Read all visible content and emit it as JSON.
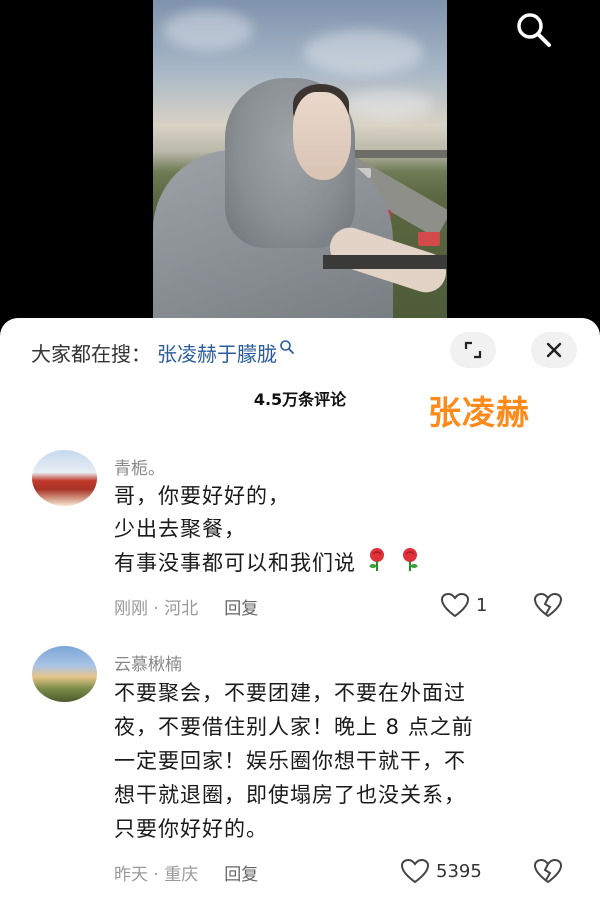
{
  "search_bar": {
    "label": "大家都在搜：",
    "term": "张凌赫于朦胧"
  },
  "comment_count": "4.5万条评论",
  "watermark": "张凌赫",
  "comments": [
    {
      "user": "青栀。",
      "lines": [
        "哥，你要好好的，",
        "少出去聚餐，",
        "有事没事都可以和我们说"
      ],
      "emoji": "rose",
      "time_location": "刚刚 · 河北",
      "reply": "回复",
      "likes": "1"
    },
    {
      "user": "云慕楸楠",
      "lines": [
        "不要聚会，不要团建，不要在外面过",
        "夜，不要借住别人家！晚上 8 点之前",
        "一定要回家！娱乐圈你想干就干，不",
        "想干就退圈，即使塌房了也没关系，",
        "只要你好好的。"
      ],
      "time_location": "昨天 · 重庆",
      "reply": "回复",
      "likes": "5395"
    }
  ],
  "icons": {
    "search": "search-icon",
    "expand": "expand-icon",
    "close": "close-icon",
    "like": "heart-icon",
    "dislike": "broken-heart-icon"
  },
  "colors": {
    "search_term": "#2b5d9c",
    "watermark": "#ff8a1c"
  }
}
